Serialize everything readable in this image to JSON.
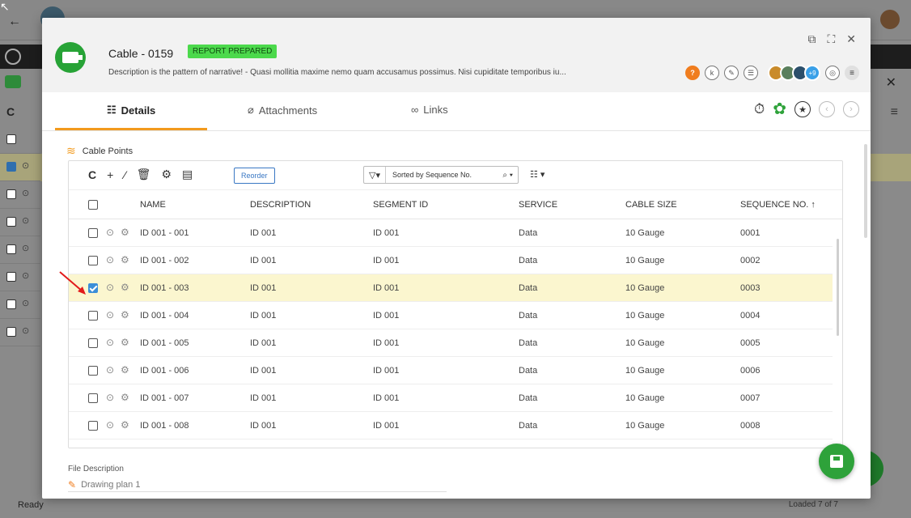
{
  "background": {
    "status_ready": "Ready",
    "status_loaded": "Loaded 7 of 7"
  },
  "modal": {
    "title": "Cable - 0159",
    "badge": "REPORT PREPARED",
    "description": "Description is the pattern of narrative! - Quasi mollitia maxime nemo quam accusamus possimus. Nisi cupiditate temporibus iu...",
    "avatars_more": "+9",
    "icon_badges": {
      "help": "?",
      "k": "k"
    }
  },
  "tabs": [
    {
      "label": "Details",
      "active": true
    },
    {
      "label": "Attachments",
      "active": false
    },
    {
      "label": "Links",
      "active": false
    }
  ],
  "section": {
    "title": "Cable Points"
  },
  "toolbar": {
    "reorder_label": "Reorder",
    "sort_label": "Sorted by Sequence No."
  },
  "table": {
    "columns": [
      "NAME",
      "DESCRIPTION",
      "SEGMENT ID",
      "SERVICE",
      "CABLE SIZE",
      "SEQUENCE NO. ↑"
    ],
    "rows": [
      {
        "name": "ID 001 - 001",
        "description": "ID 001",
        "segment": "ID 001",
        "service": "Data",
        "size": "10 Gauge",
        "seq": "0001",
        "selected": false
      },
      {
        "name": "ID 001 - 002",
        "description": "ID 001",
        "segment": "ID 001",
        "service": "Data",
        "size": "10 Gauge",
        "seq": "0002",
        "selected": false
      },
      {
        "name": "ID 001 - 003",
        "description": "ID 001",
        "segment": "ID 001",
        "service": "Data",
        "size": "10 Gauge",
        "seq": "0003",
        "selected": true
      },
      {
        "name": "ID 001 - 004",
        "description": "ID 001",
        "segment": "ID 001",
        "service": "Data",
        "size": "10 Gauge",
        "seq": "0004",
        "selected": false
      },
      {
        "name": "ID 001 - 005",
        "description": "ID 001",
        "segment": "ID 001",
        "service": "Data",
        "size": "10 Gauge",
        "seq": "0005",
        "selected": false
      },
      {
        "name": "ID 001 - 006",
        "description": "ID 001",
        "segment": "ID 001",
        "service": "Data",
        "size": "10 Gauge",
        "seq": "0006",
        "selected": false
      },
      {
        "name": "ID 001 - 007",
        "description": "ID 001",
        "segment": "ID 001",
        "service": "Data",
        "size": "10 Gauge",
        "seq": "0007",
        "selected": false
      },
      {
        "name": "ID 001 - 008",
        "description": "ID 001",
        "segment": "ID 001",
        "service": "Data",
        "size": "10 Gauge",
        "seq": "0008",
        "selected": false
      }
    ]
  },
  "file_description": {
    "label": "File Description",
    "value": "Drawing plan 1"
  },
  "colors": {
    "accent_orange": "#f29a1d",
    "brand_green": "#2ea23a",
    "badge_green": "#4cd94c",
    "selected_row": "#fbf6cf",
    "link_blue": "#3a78c4"
  }
}
